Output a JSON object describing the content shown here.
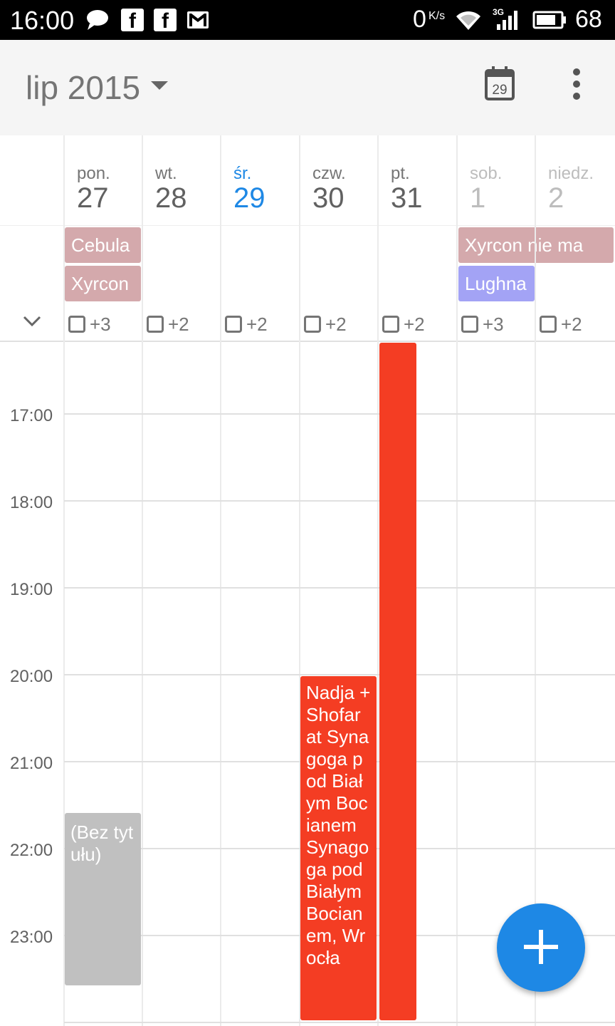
{
  "status_bar": {
    "time": "16:00",
    "icons_left": [
      "chat-icon",
      "facebook-icon",
      "facebook-icon",
      "gmail-icon"
    ],
    "net_speed": "0",
    "net_unit": "K/s",
    "signal_type": "3G",
    "battery_level": "68"
  },
  "app_bar": {
    "month_title": "lip 2015",
    "today_button_day": "29"
  },
  "days": [
    {
      "dow": "pon.",
      "num": "27",
      "more": "+3"
    },
    {
      "dow": "wt.",
      "num": "28",
      "more": "+2"
    },
    {
      "dow": "śr.",
      "num": "29",
      "more": "+2"
    },
    {
      "dow": "czw.",
      "num": "30",
      "more": "+2"
    },
    {
      "dow": "pt.",
      "num": "31",
      "more": "+2"
    },
    {
      "dow": "sob.",
      "num": "1",
      "more": "+3"
    },
    {
      "dow": "niedz.",
      "num": "2",
      "more": "+2"
    }
  ],
  "all_day_events": {
    "cebula": "Cebula",
    "xyrcon": "Xyrcon",
    "xyrcon_nie_ma": "Xyrcon nie ma",
    "lughna": "Lughna"
  },
  "hours": [
    "17:00",
    "18:00",
    "19:00",
    "20:00",
    "21:00",
    "22:00",
    "23:00"
  ],
  "events": {
    "bez_tytulu": "(Bez tytułu)",
    "nadja": "Nadja + Shofar at Synagoga pod Białym Bocianem Synagoga pod Białym Bocianem, Wrocła"
  },
  "colors": {
    "today_accent": "#1e88e5",
    "all_day_chip": "#d4a9ac",
    "lughna_chip": "#a3a3f5",
    "event_red": "#f43d23",
    "event_grey": "#c0c0c0",
    "fab": "#1e88e5"
  }
}
